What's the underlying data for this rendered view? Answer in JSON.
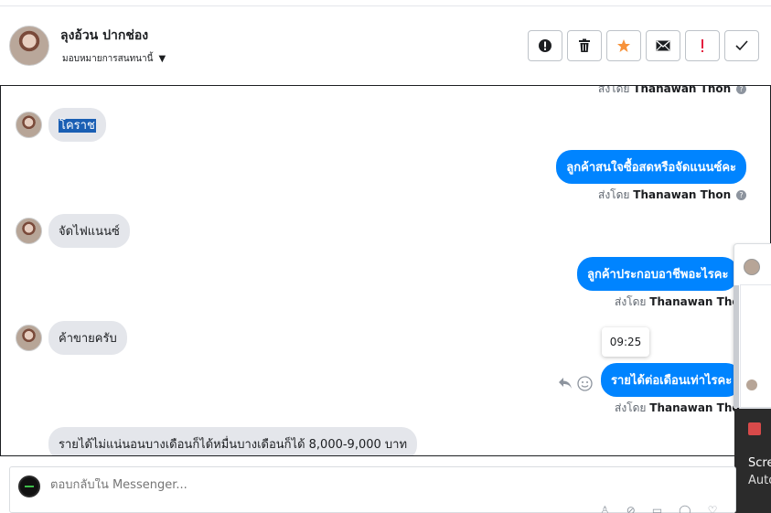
{
  "header": {
    "contact_name": "ลุงอ้วน ปากช่อง",
    "assign_label": "มอบหมายการสนทนานี้",
    "actions": [
      {
        "icon": "alert-circle-icon",
        "label": "!"
      },
      {
        "icon": "trash-icon",
        "label": "🗑"
      },
      {
        "icon": "star-icon",
        "label": "★"
      },
      {
        "icon": "envelope-icon",
        "label": "✉"
      },
      {
        "icon": "exclamation-icon",
        "label": "!"
      },
      {
        "icon": "check-icon",
        "label": "✓"
      }
    ]
  },
  "sent_by": {
    "prefix": "ส่งโดย",
    "agent": "Thanawan Thon",
    "help": "?"
  },
  "messages": {
    "partial_sent_by": {
      "prefix": "ส่งโดย",
      "agent": "Thanawan Thon"
    },
    "m1": {
      "text": "โคราช"
    },
    "m2": {
      "text": "ลูกค้าสนใจซื้อสดหรือจัดแนนซ์คะ"
    },
    "m3": {
      "text": "จัดไฟแนนซ์"
    },
    "m4": {
      "text": "ลูกค้าประกอบอาชีพอะไรคะ"
    },
    "m5": {
      "text": "ค้าขายครับ"
    },
    "m6": {
      "text": "รายได้ต่อเดือนเท่าไรคะ",
      "time": "09:25"
    },
    "m7": {
      "text": "รายได้ไม่แน่นอนบางเดือนก็ได้หมื่นบางเดือนก็ได้ 8,000-9,000 บาท"
    }
  },
  "side_panel": {
    "title": "Scre",
    "subtitle": "Auto"
  },
  "composer": {
    "placeholder": "ตอบกลับใน Messenger..."
  },
  "colors": {
    "sent_bubble": "#0084ff",
    "received_bubble": "#e4e6eb",
    "star": "#f7923a",
    "alert_red": "#e41e3f"
  }
}
